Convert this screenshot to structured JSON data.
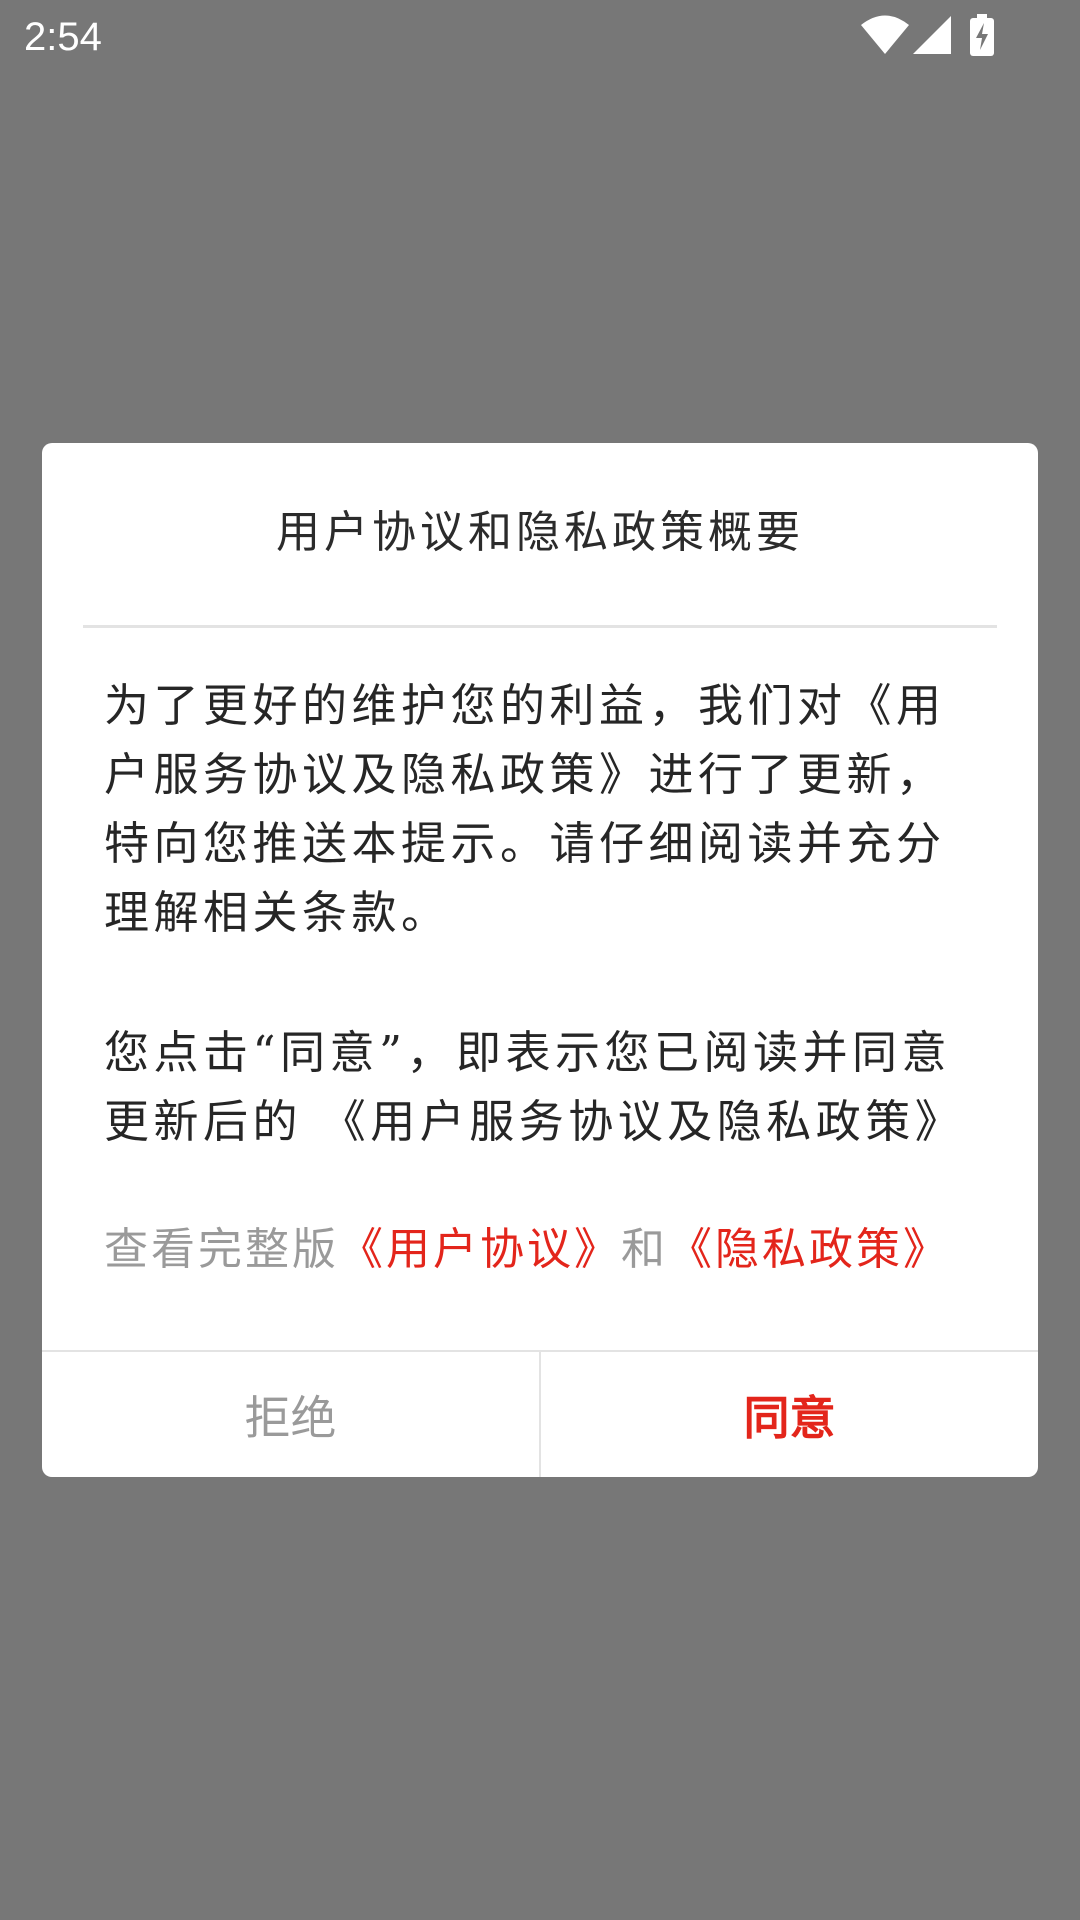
{
  "status_bar": {
    "time": "2:54",
    "icons": [
      "wifi-icon",
      "cell-signal-icon",
      "battery-charging-icon"
    ]
  },
  "dialog": {
    "title": "用户协议和隐私政策概要",
    "paragraph_1": "为了更好的维护您的利益，我们对《用户服务协议及隐私政策》进行了更新，特向您推送本提示。请仔细阅读并充分理解相关条款。",
    "paragraph_2": "您点击“同意”，即表示您已阅读并同意更新后的 《用户服务协议及隐私政策》",
    "links": {
      "prefix": "查看完整版",
      "user_agreement": "《用户协议》",
      "conjunction": "和",
      "privacy_policy": "《隐私政策》"
    },
    "buttons": {
      "reject": "拒绝",
      "agree": "同意"
    }
  },
  "colors": {
    "background_overlay": "#777777",
    "dialog_background": "#ffffff",
    "accent_red": "#e3251b",
    "muted_gray": "#9a9a9a",
    "text_dark": "#262626"
  }
}
